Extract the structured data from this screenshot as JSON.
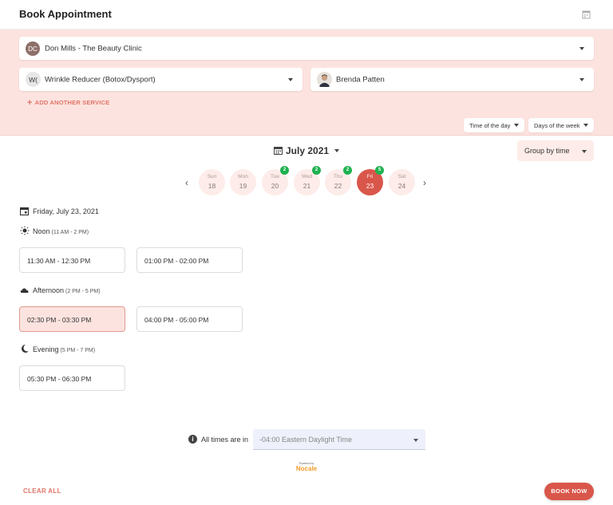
{
  "header": {
    "title": "Book Appointment"
  },
  "location": {
    "initials": "DC",
    "value": "Don Mills - The Beauty Clinic"
  },
  "service": {
    "initials": "W(",
    "value": "Wrinkle Reducer (Botox/Dysport)"
  },
  "provider": {
    "value": "Brenda Patten"
  },
  "add_service_label": "ADD ANOTHER SERVICE",
  "filters": {
    "time_of_day": "Time of the day",
    "days_of_week": "Days of the week"
  },
  "calendar": {
    "month": "July 2021",
    "group_by": "Group by time",
    "days": [
      {
        "name": "Sun",
        "date": "18",
        "badge": ""
      },
      {
        "name": "Mon",
        "date": "19",
        "badge": ""
      },
      {
        "name": "Tue",
        "date": "20",
        "badge": "2"
      },
      {
        "name": "Wed",
        "date": "21",
        "badge": "2"
      },
      {
        "name": "Thu",
        "date": "22",
        "badge": "2"
      },
      {
        "name": "Fri",
        "date": "23",
        "badge": "5"
      },
      {
        "name": "Sat",
        "date": "24",
        "badge": ""
      }
    ],
    "selected_day": "Fri"
  },
  "selected_date": "Friday, July 23, 2021",
  "sections": [
    {
      "name": "Noon",
      "range": "(11 AM - 2 PM)",
      "icon": "sun-icon",
      "slots": [
        "11:30 AM - 12:30 PM",
        "01:00 PM - 02:00 PM"
      ]
    },
    {
      "name": "Afternoon",
      "range": "(2 PM - 5 PM)",
      "icon": "cloud-icon",
      "slots": [
        "02:30 PM - 03:30 PM",
        "04:00 PM - 05:00 PM"
      ]
    },
    {
      "name": "Evening",
      "range": "(5 PM - 7 PM)",
      "icon": "moon-icon",
      "slots": [
        "05:30 PM - 06:30 PM"
      ]
    }
  ],
  "selected_slot": "02:30 PM - 03:30 PM",
  "timezone": {
    "label": "All times are in",
    "value": "-04:00 Eastern Daylight Time"
  },
  "powered": {
    "prefix": "Powered by",
    "brand": "Nocale"
  },
  "footer": {
    "clear_all": "CLEAR ALL",
    "book_now": "BOOK NOW"
  },
  "colors": {
    "accent": "#d9564a",
    "pink_bg": "#fde3df",
    "badge": "#1fb24f"
  }
}
